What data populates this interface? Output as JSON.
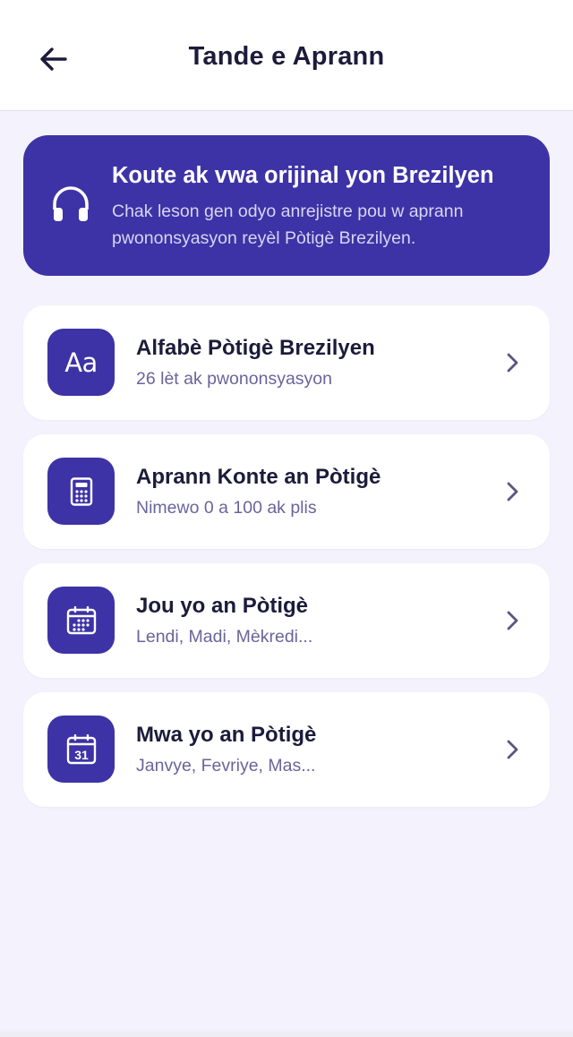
{
  "header": {
    "title": "Tande e Aprann",
    "back_icon": "arrow-left-icon"
  },
  "banner": {
    "icon": "headphones-icon",
    "title": "Koute ak vwa orijinal yon Brezilyen",
    "subtitle": "Chak leson gen odyo anrejistre pou w aprann pwononsyasyon reyèl Pòtigè Brezilyen."
  },
  "lessons": [
    {
      "icon": "alphabet-icon",
      "icon_text": "Aa",
      "title": "Alfabè Pòtigè Brezilyen",
      "subtitle": "26 lèt ak pwononsyasyon"
    },
    {
      "icon": "calculator-icon",
      "title": "Aprann Konte an Pòtigè",
      "subtitle": "Nimewo 0 a 100 ak plis"
    },
    {
      "icon": "calendar-icon",
      "title": "Jou yo an Pòtigè",
      "subtitle": "Lendi, Madi, Mèkredi..."
    },
    {
      "icon": "calendar-31-icon",
      "icon_text": "31",
      "title": "Mwa yo an Pòtigè",
      "subtitle": "Janvye, Fevriye, Mas..."
    }
  ],
  "colors": {
    "accent": "#3d33a6",
    "background": "#f4f2fd",
    "card": "#ffffff",
    "title_text": "#1c1b3a",
    "subtitle_text": "#6a649a"
  }
}
